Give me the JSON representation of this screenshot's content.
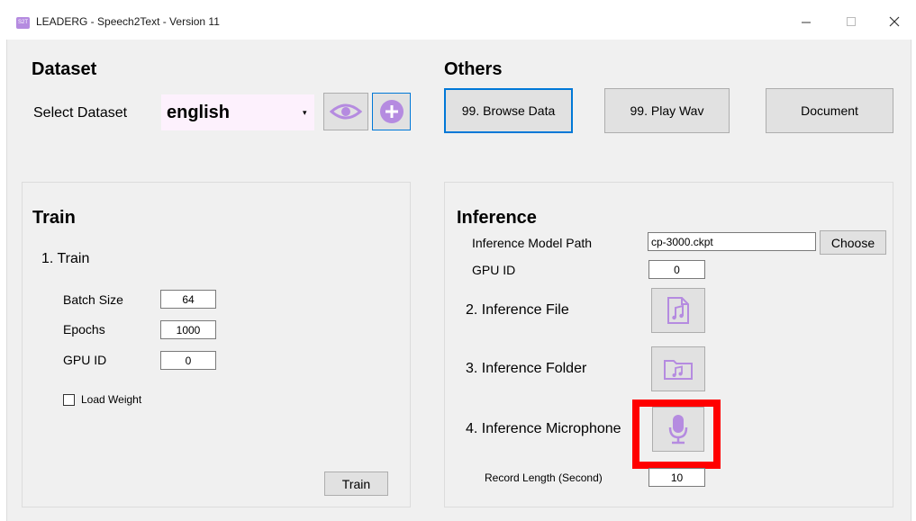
{
  "window": {
    "app_icon_text": "S2T",
    "title": "LEADERG - Speech2Text - Version 11",
    "controls": {
      "minimize": "—",
      "maximize": "☐",
      "close": "✕"
    }
  },
  "dataset": {
    "heading": "Dataset",
    "select_label": "Select Dataset",
    "selected_value": "english",
    "dropdown_arrow": "▾",
    "view_button_icon": "eye-icon",
    "add_button_icon": "plus-icon"
  },
  "others": {
    "heading": "Others",
    "browse_label": "99. Browse Data",
    "play_label": "99. Play Wav",
    "document_label": "Document"
  },
  "train": {
    "heading": "Train",
    "step_label": "1. Train",
    "batch_size_label": "Batch Size",
    "batch_size_value": "64",
    "epochs_label": "Epochs",
    "epochs_value": "1000",
    "gpu_label": "GPU ID",
    "gpu_value": "0",
    "load_weight_label": "Load Weight",
    "load_weight_checked": false,
    "train_button": "Train"
  },
  "inference": {
    "heading": "Inference",
    "model_path_label": "Inference Model Path",
    "model_path_value": "cp-3000.ckpt",
    "choose_button": "Choose",
    "gpu_label": "GPU ID",
    "gpu_value": "0",
    "file_label": "2. Inference File",
    "file_icon": "music-file-icon",
    "folder_label": "3. Inference Folder",
    "folder_icon": "music-folder-icon",
    "mic_label": "4. Inference Microphone",
    "mic_icon": "microphone-icon",
    "record_length_label": "Record Length (Second)",
    "record_length_value": "10"
  },
  "colors": {
    "accent_purple": "#b58be0",
    "highlight_red": "#ff0000",
    "focus_blue": "#0078d7",
    "combo_bg": "#fdf1fd"
  }
}
